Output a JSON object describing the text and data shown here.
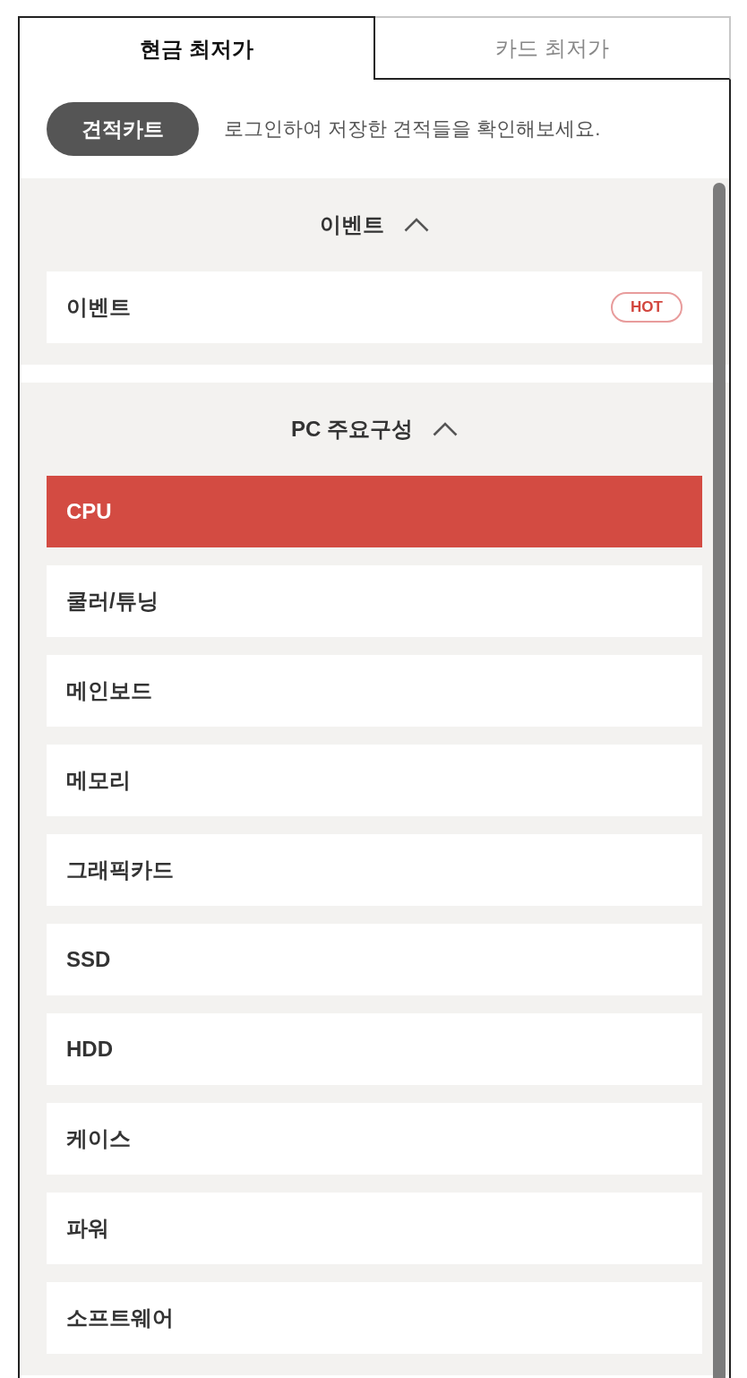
{
  "tabs": [
    {
      "label": "현금 최저가",
      "selected": true
    },
    {
      "label": "카드 최저가",
      "selected": false
    }
  ],
  "cart": {
    "button": "견적카트",
    "message": "로그인하여 저장한 견적들을 확인해보세요."
  },
  "sections": [
    {
      "title": "이벤트",
      "expanded": true,
      "items": [
        {
          "label": "이벤트",
          "badge": "HOT",
          "selected": false
        }
      ]
    },
    {
      "title": "PC 주요구성",
      "expanded": true,
      "items": [
        {
          "label": "CPU",
          "selected": true
        },
        {
          "label": "쿨러/튜닝",
          "selected": false
        },
        {
          "label": "메인보드",
          "selected": false
        },
        {
          "label": "메모리",
          "selected": false
        },
        {
          "label": "그래픽카드",
          "selected": false
        },
        {
          "label": "SSD",
          "selected": false
        },
        {
          "label": "HDD",
          "selected": false
        },
        {
          "label": "케이스",
          "selected": false
        },
        {
          "label": "파워",
          "selected": false
        },
        {
          "label": "소프트웨어",
          "selected": false
        }
      ]
    }
  ]
}
